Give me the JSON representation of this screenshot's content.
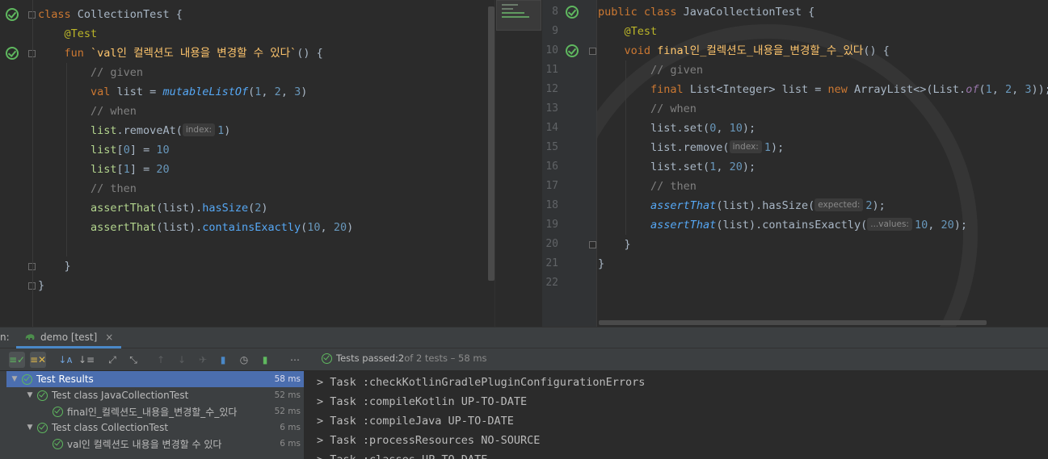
{
  "left_editor": {
    "lines": [
      {
        "tokens": [
          {
            "t": "class ",
            "c": "kw"
          },
          {
            "t": "CollectionTest {",
            "c": "cls"
          }
        ]
      },
      {
        "tokens": [
          {
            "t": "    "
          },
          {
            "t": "@Test",
            "c": "ann"
          }
        ]
      },
      {
        "tokens": [
          {
            "t": "    "
          },
          {
            "t": "fun ",
            "c": "kw"
          },
          {
            "t": "`val인 컬렉션도 내용을 변경할 수 있다`",
            "c": "fn"
          },
          {
            "t": "() {",
            "c": "cls"
          }
        ]
      },
      {
        "tokens": [
          {
            "t": "        "
          },
          {
            "t": "// given",
            "c": "cmt"
          }
        ]
      },
      {
        "tokens": [
          {
            "t": "        "
          },
          {
            "t": "val ",
            "c": "kw"
          },
          {
            "t": "list = ",
            "c": "cls"
          },
          {
            "t": "mutableListOf",
            "c": "call ital"
          },
          {
            "t": "(",
            "c": "cls"
          },
          {
            "t": "1",
            "c": "num"
          },
          {
            "t": ", ",
            "c": "cls"
          },
          {
            "t": "2",
            "c": "num"
          },
          {
            "t": ", ",
            "c": "cls"
          },
          {
            "t": "3",
            "c": "num"
          },
          {
            "t": ")",
            "c": "cls"
          }
        ]
      },
      {
        "tokens": [
          {
            "t": "        "
          },
          {
            "t": "// when",
            "c": "cmt"
          }
        ]
      },
      {
        "tokens": [
          {
            "t": "        "
          },
          {
            "t": "list",
            "c": "green"
          },
          {
            "t": ".removeAt(",
            "c": "cls"
          },
          {
            "hint": "index:"
          },
          {
            "t": "1",
            "c": "num"
          },
          {
            "t": ")",
            "c": "cls"
          }
        ]
      },
      {
        "tokens": [
          {
            "t": "        "
          },
          {
            "t": "list",
            "c": "green"
          },
          {
            "t": "[",
            "c": "cls"
          },
          {
            "t": "0",
            "c": "num"
          },
          {
            "t": "] = ",
            "c": "cls"
          },
          {
            "t": "10",
            "c": "num"
          }
        ]
      },
      {
        "tokens": [
          {
            "t": "        "
          },
          {
            "t": "list",
            "c": "green"
          },
          {
            "t": "[",
            "c": "cls"
          },
          {
            "t": "1",
            "c": "num"
          },
          {
            "t": "] = ",
            "c": "cls"
          },
          {
            "t": "20",
            "c": "num"
          }
        ]
      },
      {
        "tokens": [
          {
            "t": "        "
          },
          {
            "t": "// then",
            "c": "cmt"
          }
        ]
      },
      {
        "tokens": [
          {
            "t": "        "
          },
          {
            "t": "assertThat",
            "c": "green"
          },
          {
            "t": "(list).",
            "c": "cls"
          },
          {
            "t": "hasSize",
            "c": "call"
          },
          {
            "t": "(",
            "c": "cls"
          },
          {
            "t": "2",
            "c": "num"
          },
          {
            "t": ")",
            "c": "cls"
          }
        ]
      },
      {
        "tokens": [
          {
            "t": "        "
          },
          {
            "t": "assertThat",
            "c": "green"
          },
          {
            "t": "(list).",
            "c": "cls"
          },
          {
            "t": "containsExactly",
            "c": "call"
          },
          {
            "t": "(",
            "c": "cls"
          },
          {
            "t": "10",
            "c": "num"
          },
          {
            "t": ", ",
            "c": "cls"
          },
          {
            "t": "20",
            "c": "num"
          },
          {
            "t": ")",
            "c": "cls"
          }
        ]
      },
      {
        "tokens": []
      },
      {
        "tokens": [
          {
            "t": "    "
          },
          {
            "t": "}",
            "c": "cls"
          }
        ]
      },
      {
        "tokens": [
          {
            "t": "}",
            "c": "cls"
          }
        ]
      }
    ]
  },
  "right_editor": {
    "lines": [
      {
        "num": "8",
        "tokens": [
          {
            "t": "public class ",
            "c": "kw"
          },
          {
            "t": "JavaCollectionTest {",
            "c": "cls"
          }
        ]
      },
      {
        "num": "9",
        "tokens": [
          {
            "t": "    "
          },
          {
            "t": "@Test",
            "c": "ann"
          }
        ]
      },
      {
        "num": "10",
        "tokens": [
          {
            "t": "    "
          },
          {
            "t": "void ",
            "c": "kw"
          },
          {
            "t": "final인_컬렉션도_내용을_변경할_수_있다",
            "c": "fn"
          },
          {
            "t": "() {",
            "c": "cls"
          }
        ]
      },
      {
        "num": "11",
        "tokens": [
          {
            "t": "        "
          },
          {
            "t": "// given",
            "c": "cmt"
          }
        ]
      },
      {
        "num": "12",
        "tokens": [
          {
            "t": "        "
          },
          {
            "t": "final ",
            "c": "kw"
          },
          {
            "t": "List<Integer> list = ",
            "c": "cls"
          },
          {
            "t": "new ",
            "c": "kw"
          },
          {
            "t": "ArrayList<>(List.",
            "c": "cls"
          },
          {
            "t": "of",
            "c": "var ital"
          },
          {
            "t": "(",
            "c": "cls"
          },
          {
            "t": "1",
            "c": "num"
          },
          {
            "t": ", ",
            "c": "cls"
          },
          {
            "t": "2",
            "c": "num"
          },
          {
            "t": ", ",
            "c": "cls"
          },
          {
            "t": "3",
            "c": "num"
          },
          {
            "t": "));",
            "c": "cls"
          }
        ]
      },
      {
        "num": "13",
        "tokens": [
          {
            "t": "        "
          },
          {
            "t": "// when",
            "c": "cmt"
          }
        ]
      },
      {
        "num": "14",
        "tokens": [
          {
            "t": "        "
          },
          {
            "t": "list.set(",
            "c": "cls"
          },
          {
            "t": "0",
            "c": "num"
          },
          {
            "t": ", ",
            "c": "cls"
          },
          {
            "t": "10",
            "c": "num"
          },
          {
            "t": ");",
            "c": "cls"
          }
        ]
      },
      {
        "num": "15",
        "tokens": [
          {
            "t": "        "
          },
          {
            "t": "list.remove(",
            "c": "cls"
          },
          {
            "hint": "index:"
          },
          {
            "t": "1",
            "c": "num"
          },
          {
            "t": ");",
            "c": "cls"
          }
        ]
      },
      {
        "num": "16",
        "tokens": [
          {
            "t": "        "
          },
          {
            "t": "list.set(",
            "c": "cls"
          },
          {
            "t": "1",
            "c": "num"
          },
          {
            "t": ", ",
            "c": "cls"
          },
          {
            "t": "20",
            "c": "num"
          },
          {
            "t": ");",
            "c": "cls"
          }
        ]
      },
      {
        "num": "17",
        "tokens": [
          {
            "t": "        "
          },
          {
            "t": "// then",
            "c": "cmt"
          }
        ]
      },
      {
        "num": "18",
        "tokens": [
          {
            "t": "        "
          },
          {
            "t": "assertThat",
            "c": "call ital"
          },
          {
            "t": "(list).hasSize(",
            "c": "cls"
          },
          {
            "hint": "expected:"
          },
          {
            "t": "2",
            "c": "num"
          },
          {
            "t": ");",
            "c": "cls"
          }
        ]
      },
      {
        "num": "19",
        "tokens": [
          {
            "t": "        "
          },
          {
            "t": "assertThat",
            "c": "call ital"
          },
          {
            "t": "(list).containsExactly(",
            "c": "cls"
          },
          {
            "hint": "...values:"
          },
          {
            "t": "10",
            "c": "num"
          },
          {
            "t": ", ",
            "c": "cls"
          },
          {
            "t": "20",
            "c": "num"
          },
          {
            "t": ");",
            "c": "cls"
          }
        ]
      },
      {
        "num": "20",
        "tokens": [
          {
            "t": "    "
          },
          {
            "t": "}",
            "c": "cls"
          }
        ]
      },
      {
        "num": "21",
        "tokens": [
          {
            "t": "}",
            "c": "cls"
          }
        ]
      },
      {
        "num": "22",
        "tokens": []
      }
    ]
  },
  "run_panel": {
    "prefix": "n:",
    "tab_label": "demo [test]",
    "tab_close": "×",
    "status_prefix": "Tests passed: ",
    "status_count": "2",
    "status_suffix": " of 2 tests – 58 ms"
  },
  "toolbar_icons": [
    "show-passed-icon",
    "show-ignored-icon",
    "sort-alpha-icon",
    "sort-duration-icon",
    "expand-all-icon",
    "collapse-all-icon",
    "prev-test-icon",
    "next-test-icon",
    "rerun-icon",
    "export-icon",
    "history-icon",
    "import-icon",
    "more-icon"
  ],
  "test_tree": [
    {
      "label": "Test Results",
      "duration": "58 ms",
      "indent": 0,
      "expanded": true,
      "selected": true
    },
    {
      "label": "Test class JavaCollectionTest",
      "duration": "52 ms",
      "indent": 1,
      "expanded": true,
      "selected": false
    },
    {
      "label": "final인_컬렉션도_내용을_변경할_수_있다",
      "duration": "52 ms",
      "indent": 2,
      "expanded": null,
      "selected": false
    },
    {
      "label": "Test class CollectionTest",
      "duration": "6 ms",
      "indent": 1,
      "expanded": true,
      "selected": false
    },
    {
      "label": "val인 컬렉션도 내용을 변경할 수 있다",
      "duration": "6 ms",
      "indent": 2,
      "expanded": null,
      "selected": false
    }
  ],
  "console_lines": [
    "> Task :checkKotlinGradlePluginConfigurationErrors",
    "> Task :compileKotlin UP-TO-DATE",
    "> Task :compileJava UP-TO-DATE",
    "> Task :processResources NO-SOURCE",
    "> Task :classes UP-TO-DATE"
  ]
}
